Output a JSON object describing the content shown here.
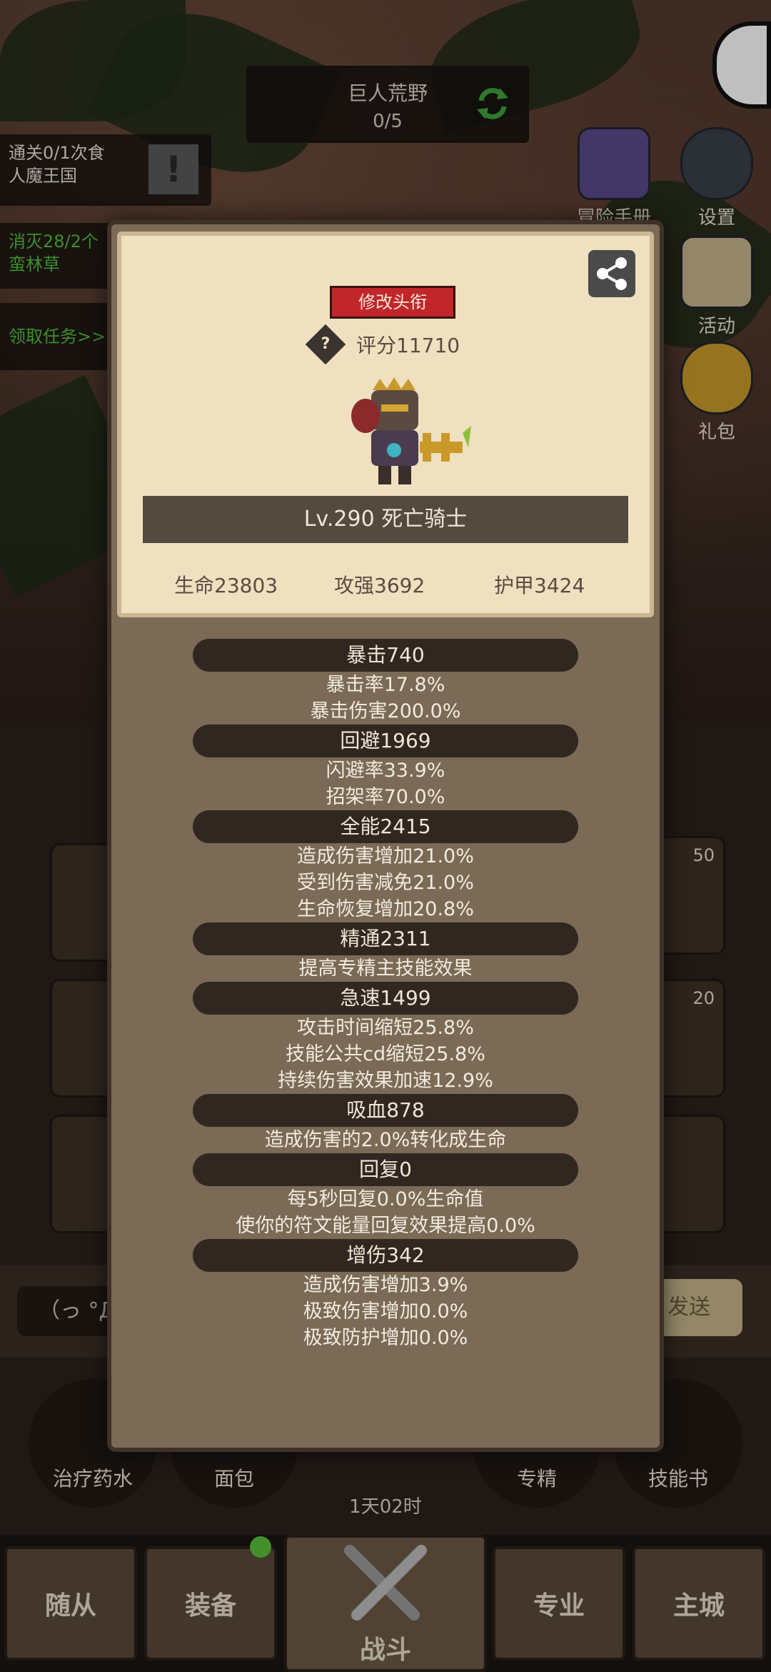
{
  "top": {
    "zone_name": "巨人荒野",
    "zone_progress": "0/5",
    "quests": [
      {
        "text": "通关0/1次食\n人魔王国",
        "color": "white"
      },
      {
        "text": "消灭28/2个\n蛮林草",
        "color": "green"
      },
      {
        "text": "领取任务>>",
        "color": "green"
      }
    ],
    "side_buttons": [
      {
        "label": "冒险手册",
        "icon": "book-icon"
      },
      {
        "label": "设置",
        "icon": "gear-icon"
      },
      {
        "label": "活动",
        "icon": "scroll-icon"
      },
      {
        "label": "礼包",
        "icon": "gift-icon"
      }
    ]
  },
  "modal": {
    "title_button": "修改头衔",
    "help_symbol": "?",
    "score": "评分11710",
    "level_name": "Lv.290 死亡骑士",
    "base_stats": [
      "生命23803",
      "攻强3692",
      "护甲3424"
    ],
    "stat_groups": [
      {
        "head": "暴击740",
        "lines": [
          "暴击率17.8%",
          "暴击伤害200.0%"
        ]
      },
      {
        "head": "回避1969",
        "lines": [
          "闪避率33.9%",
          "招架率70.0%"
        ]
      },
      {
        "head": "全能2415",
        "lines": [
          "造成伤害增加21.0%",
          "受到伤害减免21.0%",
          "生命恢复增加20.8%"
        ]
      },
      {
        "head": "精通2311",
        "lines": [
          "提高专精主技能效果"
        ]
      },
      {
        "head": "急速1499",
        "lines": [
          "攻击时间缩短25.8%",
          "技能公共cd缩短25.8%",
          "持续伤害效果加速12.9%"
        ]
      },
      {
        "head": "吸血878",
        "lines": [
          "造成伤害的2.0%转化成生命"
        ]
      },
      {
        "head": "回复0",
        "lines": [
          "每5秒回复0.0%生命值",
          "使你的符文能量回复效果提高0.0%"
        ]
      },
      {
        "head": "增伤342",
        "lines": [
          "造成伤害增加3.9%",
          "极致伤害增加0.0%",
          "极致防护增加0.0%"
        ]
      }
    ]
  },
  "slots": {
    "badges": [
      "50",
      "20"
    ]
  },
  "chat": {
    "input_text": "（っ °Д °",
    "send_label": "发送"
  },
  "consumables": [
    "治疗药水",
    "面包",
    "专精",
    "技能书"
  ],
  "timer": "1天02时",
  "nav": {
    "tabs": [
      "随从",
      "装备",
      "战斗",
      "专业",
      "主城"
    ]
  },
  "colors": {
    "accent_red": "#c0262a",
    "quest_green": "#4fbf3a",
    "panel": "#7a6a56",
    "card": "#efe0c0"
  }
}
